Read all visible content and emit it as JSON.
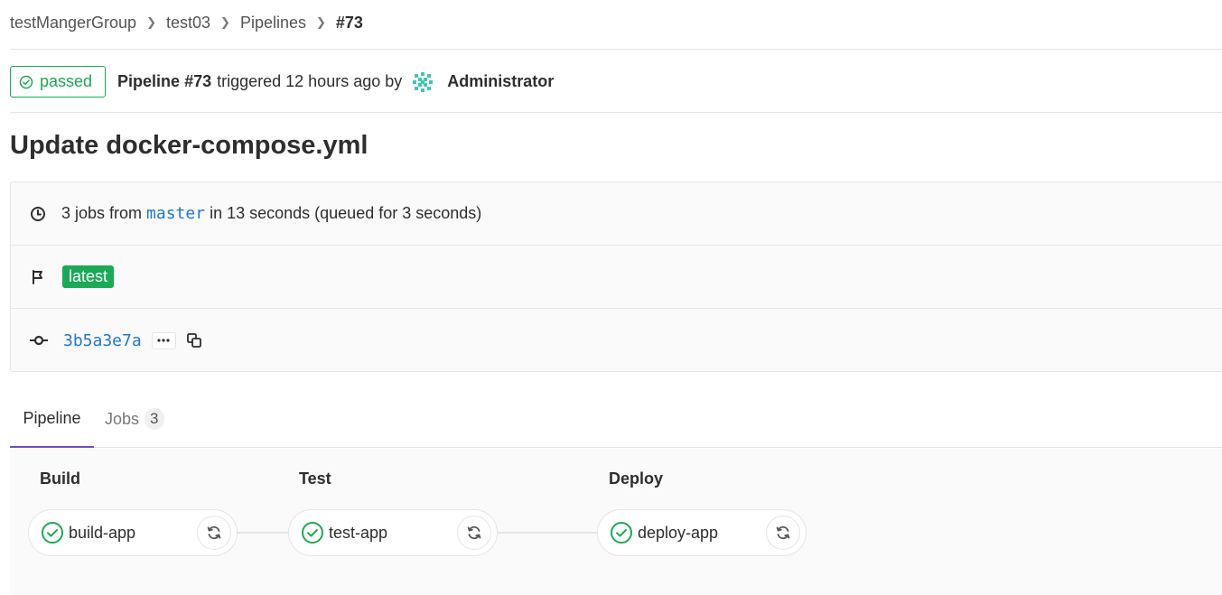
{
  "breadcrumb": {
    "items": [
      "testMangerGroup",
      "test03",
      "Pipelines"
    ],
    "current": "#73"
  },
  "header": {
    "status": "passed",
    "pipeline_label": "Pipeline #73",
    "triggered_text": "triggered 12 hours ago by",
    "user": "Administrator"
  },
  "title": "Update docker-compose.yml",
  "info": {
    "jobs_prefix": "3 jobs from",
    "branch": "master",
    "jobs_suffix": "in 13 seconds (queued for 3 seconds)",
    "tag": "latest",
    "commit_sha": "3b5a3e7a"
  },
  "tabs": {
    "pipeline": "Pipeline",
    "jobs": "Jobs",
    "jobs_count": "3"
  },
  "stages": [
    {
      "name": "Build",
      "job": "build-app"
    },
    {
      "name": "Test",
      "job": "test-app"
    },
    {
      "name": "Deploy",
      "job": "deploy-app"
    }
  ],
  "colors": {
    "success": "#1aaa55",
    "link": "#1f78d1",
    "active_tab": "#6b4fbb"
  },
  "icons": {
    "status": "check-circle-icon",
    "clock": "clock-icon",
    "flag": "flag-icon",
    "commit": "commit-icon",
    "copy": "copy-icon",
    "retry": "retry-icon"
  }
}
